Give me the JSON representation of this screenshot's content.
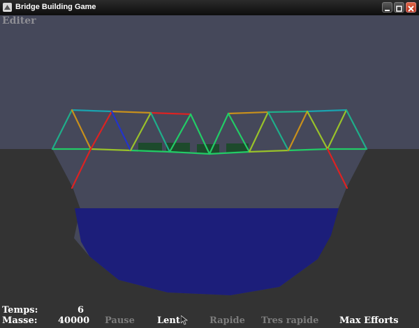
{
  "window": {
    "title": "Bridge Building Game"
  },
  "editor": {
    "edit_label": "Editer"
  },
  "hud": {
    "time_label": "Temps:",
    "time_value": "6",
    "mass_label": "Masse:",
    "mass_value": "40000"
  },
  "controls": {
    "pause": "Pause",
    "slow": "Lent",
    "fast": "Rapide",
    "very_fast": "Tres rapide",
    "max_stress": "Max Efforts",
    "selected_speed": "Lent"
  },
  "colors": {
    "sky": "#45485a",
    "ground": "#333333",
    "water": "#1c1e7a",
    "deck_panel": "#1d4a2c",
    "low_stress": "#22cc66",
    "high_stress": "#dd2222",
    "compression": "#2233cc"
  }
}
